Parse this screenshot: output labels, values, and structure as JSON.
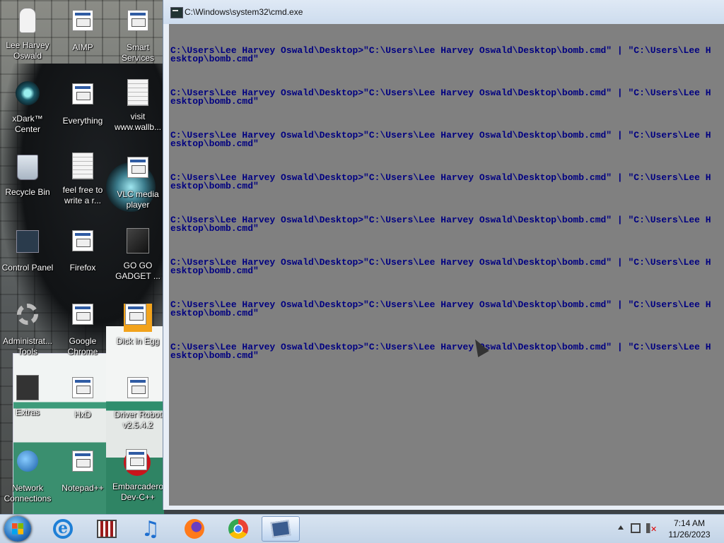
{
  "desktop": {
    "icons": [
      {
        "id": "lee-harvey-oswald",
        "label": "Lee Harvey Oswald"
      },
      {
        "id": "aimp",
        "label": "AIMP"
      },
      {
        "id": "smart-services",
        "label": "Smart Services"
      },
      {
        "id": "xdark-center",
        "label": "xDark™ Center"
      },
      {
        "id": "everything",
        "label": "Everything"
      },
      {
        "id": "visit-wallb",
        "label": "visit www.wallb..."
      },
      {
        "id": "recycle-bin",
        "label": "Recycle Bin"
      },
      {
        "id": "feel-free",
        "label": "feel free to write a r..."
      },
      {
        "id": "vlc",
        "label": "VLC media player"
      },
      {
        "id": "control-panel",
        "label": "Control Panel"
      },
      {
        "id": "firefox",
        "label": "Firefox"
      },
      {
        "id": "go-go-gadget",
        "label": "GO GO GADGET ..."
      },
      {
        "id": "admin-tools",
        "label": "Administrat... Tools"
      },
      {
        "id": "google-chrome",
        "label": "Google Chrome"
      },
      {
        "id": "dick-in-egg",
        "label": "Dick in Egg"
      },
      {
        "id": "extras",
        "label": "Extras"
      },
      {
        "id": "hxd",
        "label": "HxD"
      },
      {
        "id": "driver-robot",
        "label": "Driver Robot v2.5.4.2"
      },
      {
        "id": "network-connections",
        "label": "Network Connections"
      },
      {
        "id": "notepad-pp",
        "label": "Notepad++"
      },
      {
        "id": "embarcadero",
        "label": "Embarcadero Dev-C++"
      }
    ]
  },
  "cmd_window": {
    "title": "C:\\Windows\\system32\\cmd.exe",
    "lines": [
      "C:\\Users\\Lee Harvey Oswald\\Desktop>\"C:\\Users\\Lee Harvey Oswald\\Desktop\\bomb.cmd\" | \"C:\\Users\\Lee H\nesktop\\bomb.cmd\"",
      "C:\\Users\\Lee Harvey Oswald\\Desktop>\"C:\\Users\\Lee Harvey Oswald\\Desktop\\bomb.cmd\" | \"C:\\Users\\Lee H\nesktop\\bomb.cmd\"",
      "C:\\Users\\Lee Harvey Oswald\\Desktop>\"C:\\Users\\Lee Harvey Oswald\\Desktop\\bomb.cmd\" | \"C:\\Users\\Lee H\nesktop\\bomb.cmd\"",
      "C:\\Users\\Lee Harvey Oswald\\Desktop>\"C:\\Users\\Lee Harvey Oswald\\Desktop\\bomb.cmd\" | \"C:\\Users\\Lee H\nesktop\\bomb.cmd\"",
      "C:\\Users\\Lee Harvey Oswald\\Desktop>\"C:\\Users\\Lee Harvey Oswald\\Desktop\\bomb.cmd\" | \"C:\\Users\\Lee H\nesktop\\bomb.cmd\"",
      "C:\\Users\\Lee Harvey Oswald\\Desktop>\"C:\\Users\\Lee Harvey Oswald\\Desktop\\bomb.cmd\" | \"C:\\Users\\Lee H\nesktop\\bomb.cmd\"",
      "C:\\Users\\Lee Harvey Oswald\\Desktop>\"C:\\Users\\Lee Harvey Oswald\\Desktop\\bomb.cmd\" | \"C:\\Users\\Lee H\nesktop\\bomb.cmd\"",
      "C:\\Users\\Lee Harvey Oswald\\Desktop>\"C:\\Users\\Lee Harvey Oswald\\Desktop\\bomb.cmd\" | \"C:\\Users\\Lee H\nesktop\\bomb.cmd\""
    ],
    "console_bg": "#808080",
    "console_fg": "#000080"
  },
  "taskbar": {
    "pinned": [
      {
        "id": "internet-explorer",
        "icon": "ie-icon"
      },
      {
        "id": "media-player-film",
        "icon": "film-icon"
      },
      {
        "id": "aimp-music",
        "icon": "music-note-icon"
      },
      {
        "id": "firefox",
        "icon": "firefox-icon"
      },
      {
        "id": "chrome",
        "icon": "chrome-icon"
      },
      {
        "id": "cmd",
        "icon": "cmd-icon",
        "active": true
      }
    ],
    "clock": {
      "time": "7:14 AM",
      "date": "11/26/2023"
    }
  }
}
